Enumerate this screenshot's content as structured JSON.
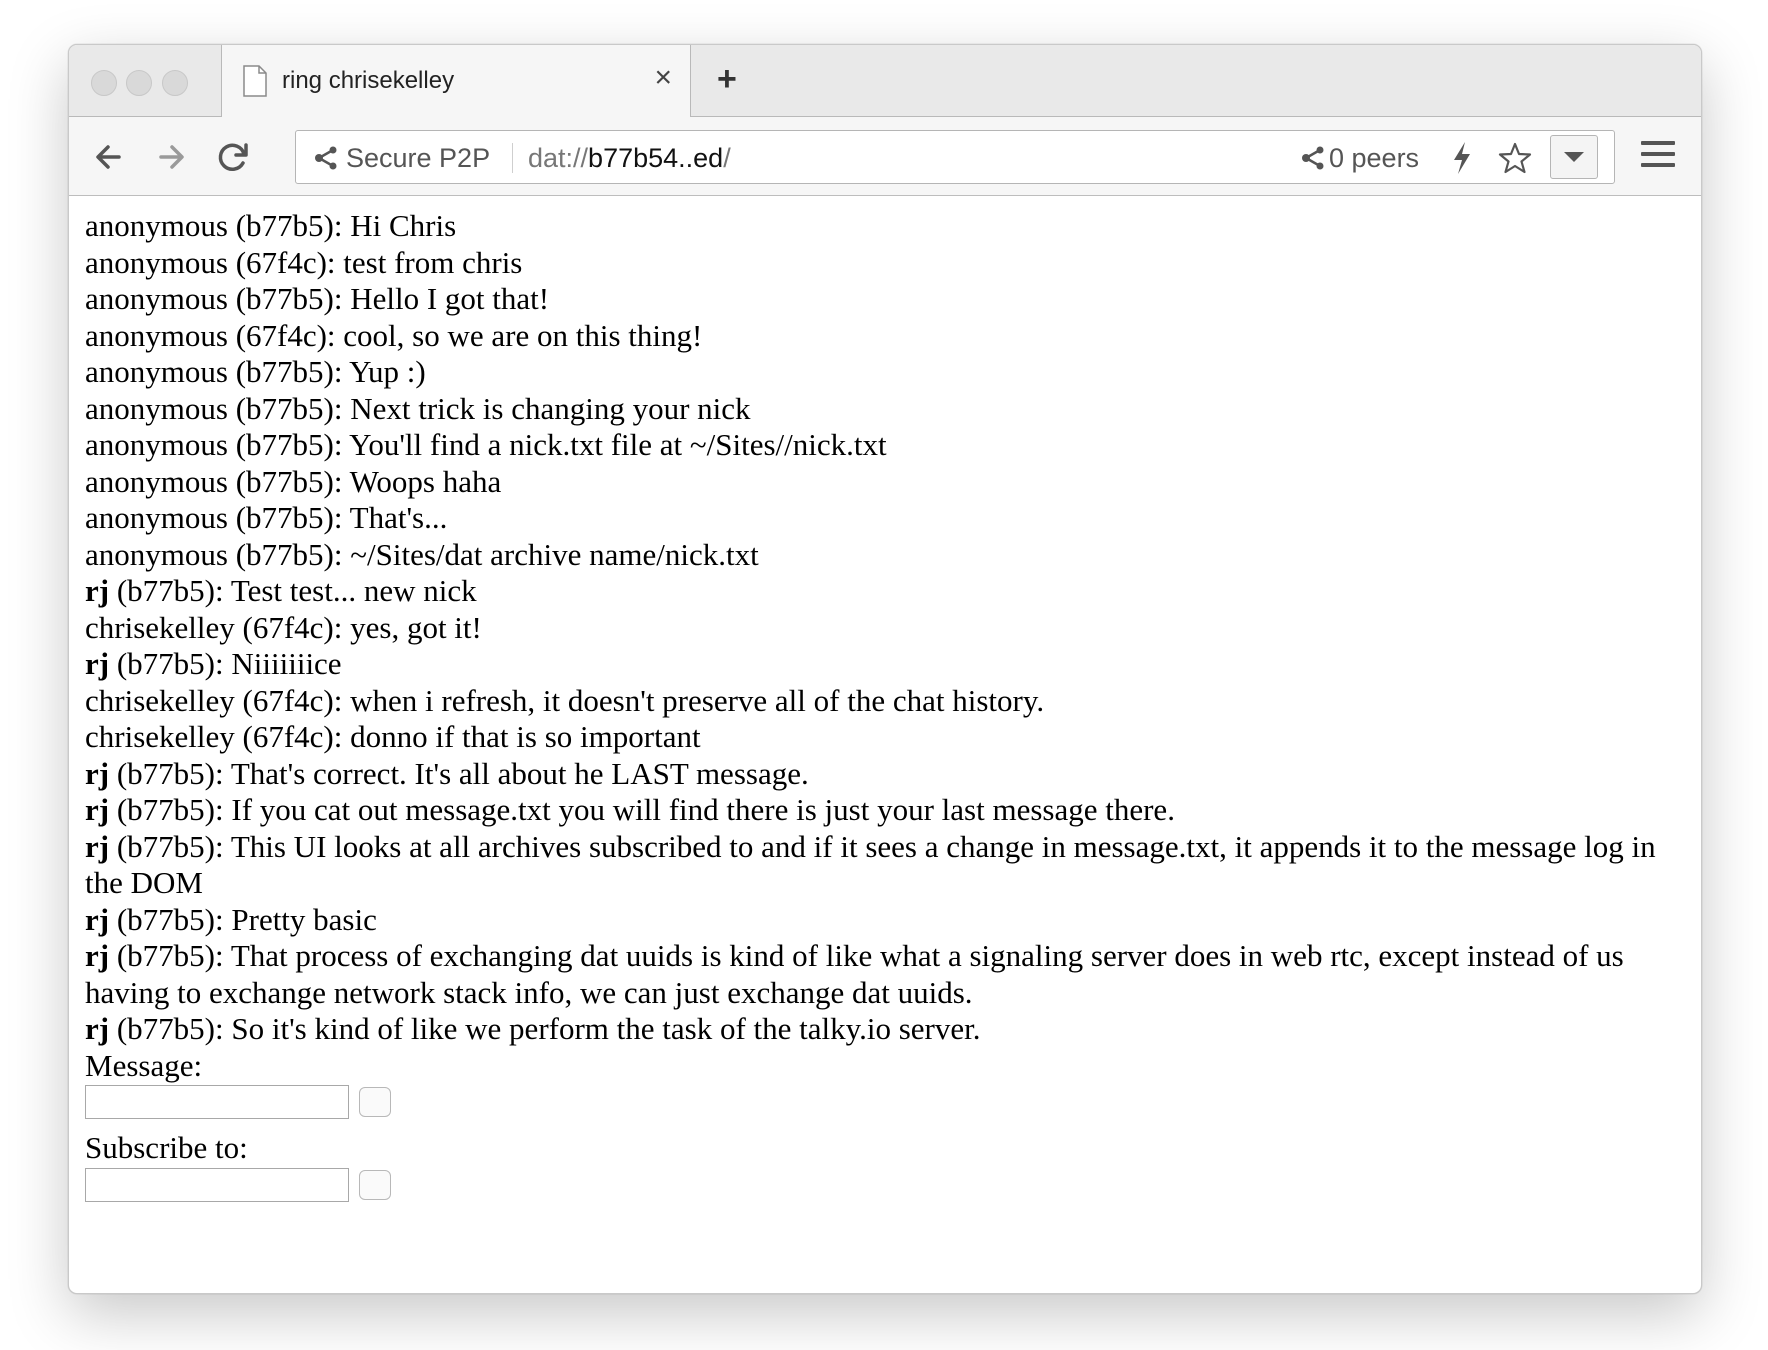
{
  "window": {
    "tab_title": "ring chrisekelley",
    "tab_close": "×",
    "new_tab": "+"
  },
  "toolbar": {
    "secure_label": "Secure P2P",
    "url_scheme": "dat://",
    "url_host": "b77b54..ed",
    "url_trailing": "/",
    "peers_label": "0 peers"
  },
  "icons": {
    "back": "back-arrow-icon",
    "forward": "forward-arrow-icon",
    "reload": "reload-icon",
    "share": "share-icon",
    "bolt": "lightning-icon",
    "star": "star-icon",
    "menu": "hamburger-menu-icon"
  },
  "messages": [
    {
      "nick": "anonymous",
      "bold": false,
      "id": "(b77b5)",
      "text": "Hi Chris"
    },
    {
      "nick": "anonymous",
      "bold": false,
      "id": "(67f4c)",
      "text": "test from chris"
    },
    {
      "nick": "anonymous",
      "bold": false,
      "id": "(b77b5)",
      "text": "Hello I got that!"
    },
    {
      "nick": "anonymous",
      "bold": false,
      "id": "(67f4c)",
      "text": "cool, so we are on this thing!"
    },
    {
      "nick": "anonymous",
      "bold": false,
      "id": "(b77b5)",
      "text": "Yup :)"
    },
    {
      "nick": "anonymous",
      "bold": false,
      "id": "(b77b5)",
      "text": "Next trick is changing your nick"
    },
    {
      "nick": "anonymous",
      "bold": false,
      "id": "(b77b5)",
      "text": "You'll find a nick.txt file at ~/Sites//nick.txt"
    },
    {
      "nick": "anonymous",
      "bold": false,
      "id": "(b77b5)",
      "text": "Woops haha"
    },
    {
      "nick": "anonymous",
      "bold": false,
      "id": "(b77b5)",
      "text": "That's..."
    },
    {
      "nick": "anonymous",
      "bold": false,
      "id": "(b77b5)",
      "text": "~/Sites/dat archive name/nick.txt"
    },
    {
      "nick": "rj",
      "bold": true,
      "id": "(b77b5)",
      "text": "Test test... new nick"
    },
    {
      "nick": "chrisekelley",
      "bold": false,
      "id": "(67f4c)",
      "text": "yes, got it!"
    },
    {
      "nick": "rj",
      "bold": true,
      "id": "(b77b5)",
      "text": "Niiiiiiice"
    },
    {
      "nick": "chrisekelley",
      "bold": false,
      "id": "(67f4c)",
      "text": "when i refresh, it doesn't preserve all of the chat history."
    },
    {
      "nick": "chrisekelley",
      "bold": false,
      "id": "(67f4c)",
      "text": "donno if that is so important"
    },
    {
      "nick": "rj",
      "bold": true,
      "id": "(b77b5)",
      "text": "That's correct. It's all about he LAST message."
    },
    {
      "nick": "rj",
      "bold": true,
      "id": "(b77b5)",
      "text": "If you cat out message.txt you will find there is just your last message there."
    },
    {
      "nick": "rj",
      "bold": true,
      "id": "(b77b5)",
      "text": "This UI looks at all archives subscribed to and if it sees a change in message.txt, it appends it to the message log in the DOM"
    },
    {
      "nick": "rj",
      "bold": true,
      "id": "(b77b5)",
      "text": "Pretty basic"
    },
    {
      "nick": "rj",
      "bold": true,
      "id": "(b77b5)",
      "text": "That process of exchanging dat uuids is kind of like what a signaling server does in web rtc, except instead of us having to exchange network stack info, we can just exchange dat uuids."
    },
    {
      "nick": "rj",
      "bold": true,
      "id": "(b77b5)",
      "text": "So it's kind of like we perform the task of the talky.io server."
    }
  ],
  "form": {
    "message_label": "Message:",
    "message_value": "",
    "subscribe_label": "Subscribe to:",
    "subscribe_value": ""
  }
}
